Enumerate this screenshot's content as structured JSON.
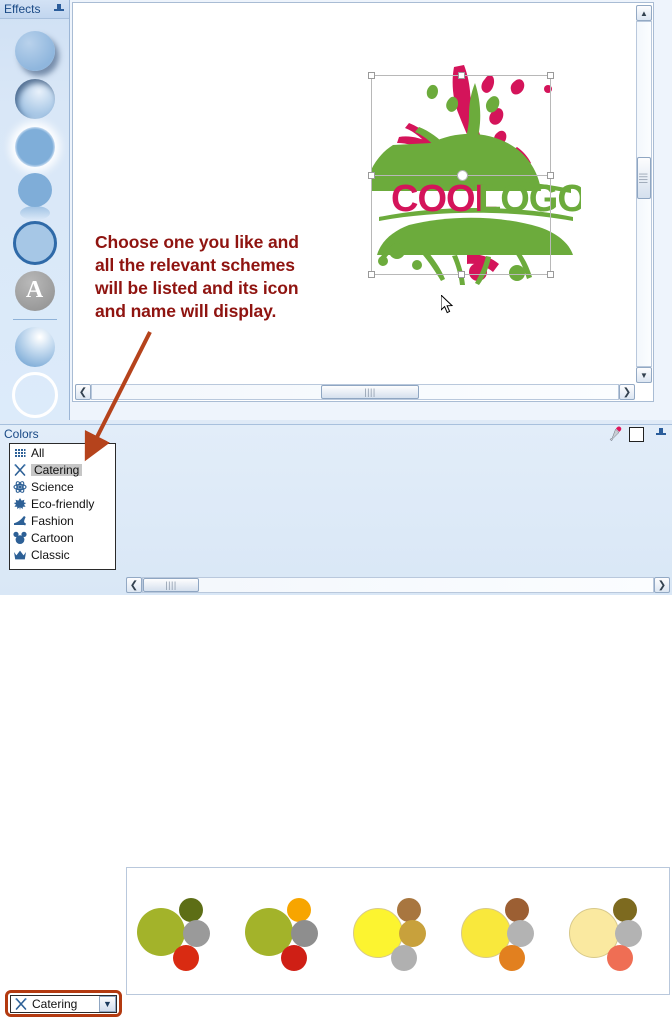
{
  "effects_panel": {
    "title": "Effects",
    "pin_icon": "pin-icon",
    "items": [
      {
        "name": "drop-shadow-effect",
        "icon": "circle-drop-shadow-icon"
      },
      {
        "name": "inner-shadow-effect",
        "icon": "circle-inner-shadow-icon"
      },
      {
        "name": "outer-glow-effect",
        "icon": "circle-glow-icon"
      },
      {
        "name": "reflection-effect",
        "icon": "circle-reflection-icon"
      },
      {
        "name": "outline-effect",
        "icon": "circle-outline-icon"
      },
      {
        "name": "text-effect",
        "icon": "letter-a-icon",
        "glyph": "A"
      },
      {
        "name": "gloss-effect",
        "icon": "circle-gloss-icon"
      },
      {
        "name": "ring-effect",
        "icon": "circle-ring-icon"
      }
    ]
  },
  "canvas": {
    "annotation_lines": [
      "Choose one you like and",
      "all the relevant schemes",
      "will be listed and its icon",
      "and name will display."
    ],
    "annotation_color": "#8f1410",
    "arrow_color": "#b5431c",
    "logo": {
      "name": "cool-logo-graphic",
      "text_part_1": "COOL",
      "text_part_2": "LOGO",
      "color_1": "#d4145a",
      "color_2": "#6cab3c"
    }
  },
  "scrollbars": {
    "up_arrow": "▲",
    "down_arrow": "▼",
    "left_arrow": "❮",
    "right_arrow": "❯",
    "grip": "||||"
  },
  "colors_panel": {
    "title": "Colors",
    "eyedropper_icon": "eyedropper-icon",
    "current_color": "#ffffff",
    "pin_icon": "pin-icon",
    "categories": [
      {
        "label": "All",
        "icon": "grid-dots-icon",
        "selected": false
      },
      {
        "label": "Catering",
        "icon": "fork-knife-icon",
        "selected": true
      },
      {
        "label": "Science",
        "icon": "atom-icon",
        "selected": false
      },
      {
        "label": "Eco-friendly",
        "icon": "leaf-icon",
        "selected": false
      },
      {
        "label": "Fashion",
        "icon": "high-heel-icon",
        "selected": false
      },
      {
        "label": "Cartoon",
        "icon": "mouse-ears-icon",
        "selected": false
      },
      {
        "label": "Classic",
        "icon": "crown-icon",
        "selected": false
      }
    ],
    "combo": {
      "value": "Catering",
      "icon": "fork-knife-icon",
      "arrow": "▼",
      "highlight_color": "#b33a10"
    },
    "swatches": [
      {
        "name": "scheme-1",
        "main": "#a3b32a",
        "dots": [
          "#5d6e16",
          "#9a9a9a",
          "#d92b12"
        ]
      },
      {
        "name": "scheme-2",
        "main": "#a3b32a",
        "dots": [
          "#f7a500",
          "#8e8e8e",
          "#cf1f15"
        ]
      },
      {
        "name": "scheme-3",
        "main": "#fcf430",
        "dots": [
          "#a8763f",
          "#c8a13c",
          "#b0b0b0"
        ]
      },
      {
        "name": "scheme-4",
        "main": "#f9e83c",
        "dots": [
          "#9c5f33",
          "#b3b3b3",
          "#e2801f"
        ]
      },
      {
        "name": "scheme-5",
        "main": "#fae9a0",
        "dots": [
          "#7d6a1f",
          "#b3b3b3",
          "#ef6e54"
        ]
      },
      {
        "name": "scheme-6",
        "main": "#fbf5cf",
        "dots": []
      }
    ]
  }
}
